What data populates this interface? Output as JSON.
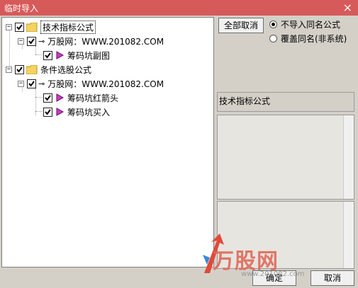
{
  "window": {
    "title": "临时导入",
    "close_glyph": "×"
  },
  "tree": {
    "nodes": [
      {
        "label": "技术指标公式",
        "type": "folder",
        "checked": true
      },
      {
        "label": "万股网：WWW.201082.COM",
        "type": "key",
        "checked": true
      },
      {
        "label": "筹码坑副图",
        "type": "formula",
        "checked": true
      },
      {
        "label": "条件选股公式",
        "type": "folder",
        "checked": true
      },
      {
        "label": "万股网：WWW.201082.COM",
        "type": "key",
        "checked": true
      },
      {
        "label": "筹码坑红箭头",
        "type": "formula",
        "checked": true
      },
      {
        "label": "筹码坑买入",
        "type": "formula",
        "checked": true
      }
    ]
  },
  "controls": {
    "deselect_all": "全部取消",
    "radio_no_import": "不导入同名公式",
    "radio_overwrite": "覆盖同名(非系统)",
    "category_label": "技术指标公式"
  },
  "footer": {
    "ok": "确定",
    "cancel": "取消"
  },
  "watermark": {
    "brand": "万股网",
    "url": "www.201082.com"
  },
  "colors": {
    "titlebar": "#d75a5a",
    "formula_icon": "#c040c0",
    "folder": "#f4d35e"
  }
}
